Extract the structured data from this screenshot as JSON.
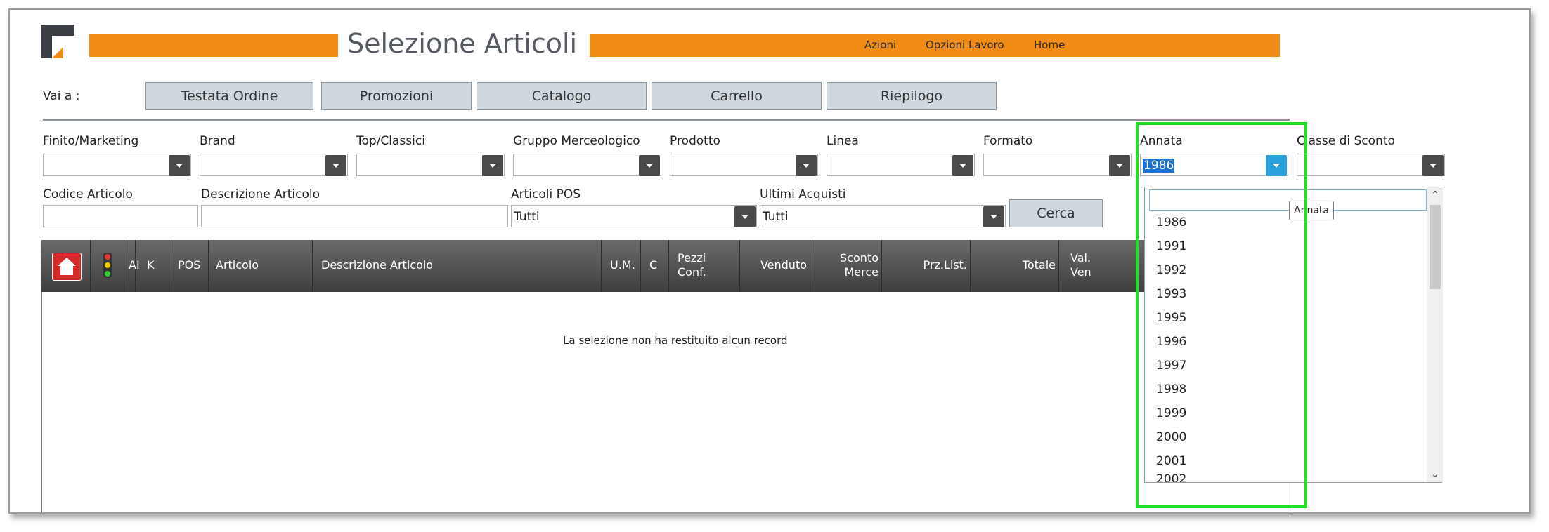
{
  "header": {
    "title": "Selezione Articoli",
    "menu": [
      "Azioni",
      "Opzioni Lavoro",
      "Home"
    ]
  },
  "nav": {
    "label": "Vai a :",
    "buttons": [
      "Testata Ordine",
      "Promozioni",
      "Catalogo",
      "Carrello",
      "Riepilogo"
    ]
  },
  "filters": {
    "row1": [
      {
        "label": "Finito/Marketing",
        "value": ""
      },
      {
        "label": "Brand",
        "value": ""
      },
      {
        "label": "Top/Classici",
        "value": ""
      },
      {
        "label": "Gruppo Merceologico",
        "value": ""
      },
      {
        "label": "Prodotto",
        "value": ""
      },
      {
        "label": "Linea",
        "value": ""
      },
      {
        "label": "Formato",
        "value": ""
      },
      {
        "label": "Annata",
        "value": "1986"
      },
      {
        "label": "Classe di Sconto",
        "value": ""
      }
    ],
    "row2": {
      "codice_label": "Codice Articolo",
      "descrizione_label": "Descrizione Articolo",
      "pos_label": "Articoli POS",
      "pos_value": "Tutti",
      "ultimi_label": "Ultimi Acquisti",
      "ultimi_value": "Tutti",
      "search_button": "Cerca"
    }
  },
  "grid": {
    "columns": [
      "AI",
      "K",
      "POS",
      "Articolo",
      "Descrizione Articolo",
      "U.M.",
      "C",
      "Pezzi Conf.",
      "Venduto",
      "Sconto Merce",
      "Prz.List.",
      "Totale",
      "Val. Ven"
    ],
    "empty_message": "La selezione non ha restituito alcun record"
  },
  "dropdown": {
    "tooltip": "Annata",
    "filter_value": "",
    "items": [
      "1986",
      "1991",
      "1992",
      "1993",
      "1995",
      "1996",
      "1997",
      "1998",
      "1999",
      "2000",
      "2001",
      "2002"
    ]
  },
  "colors": {
    "accent": "#f08c16",
    "header_dark": "#4a4a4a",
    "highlight": "#22e022",
    "dropdown_active": "#2aa0dd"
  }
}
